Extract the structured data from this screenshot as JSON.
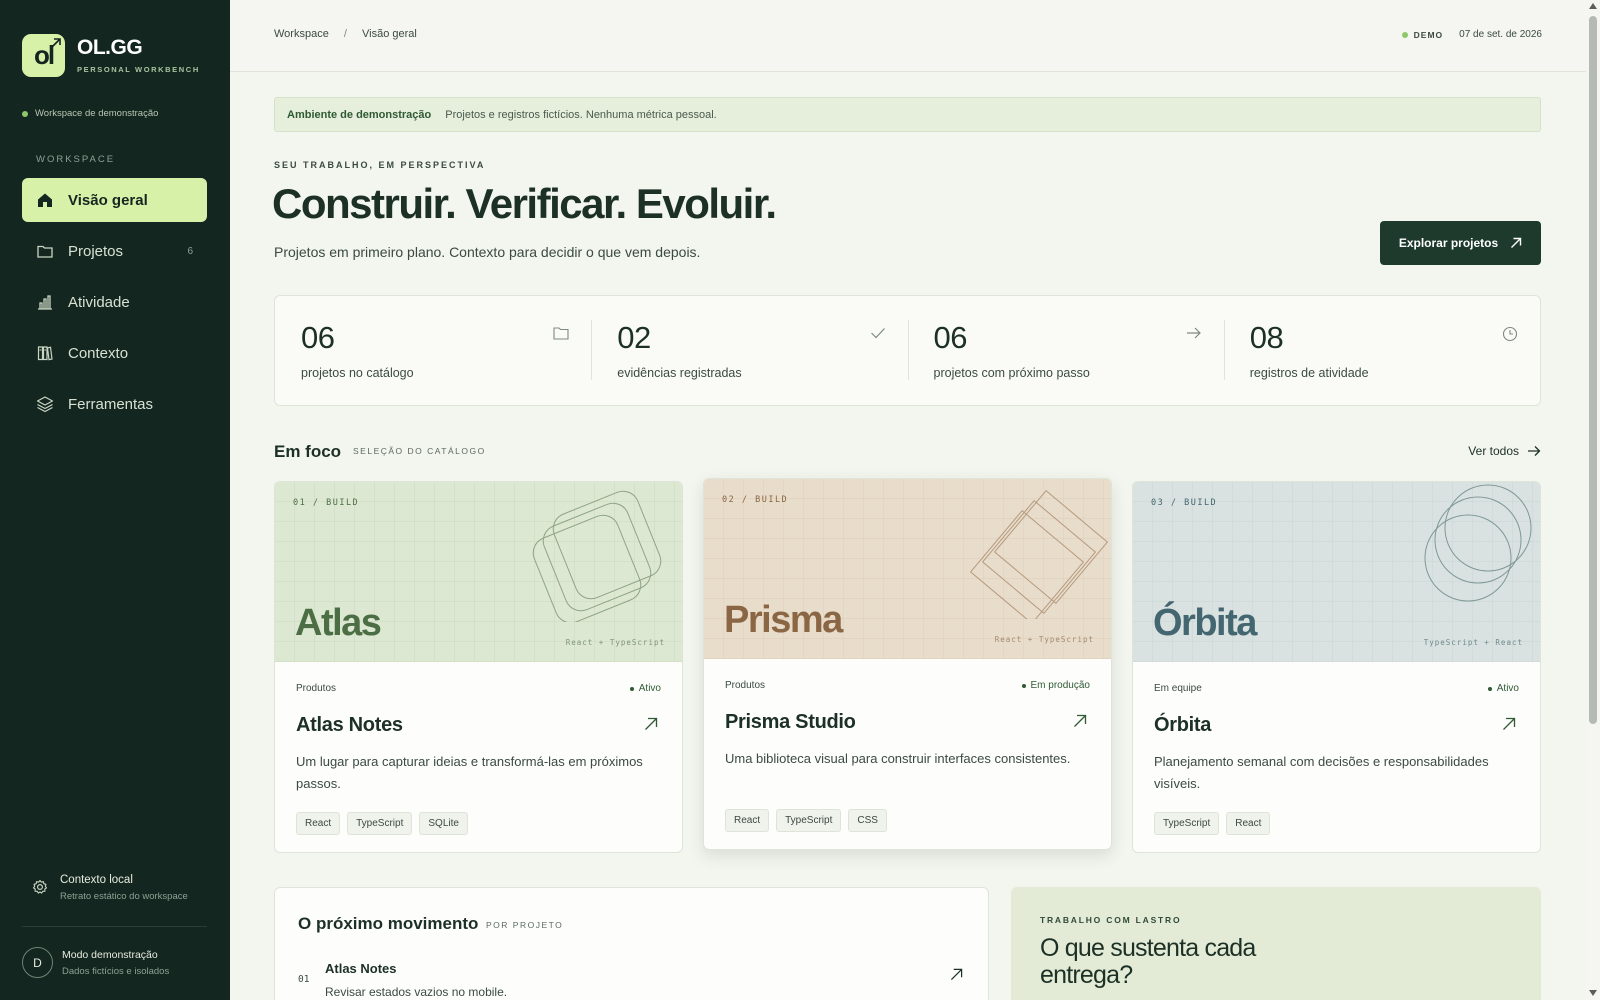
{
  "brand": {
    "logo_text": "ol",
    "name": "OL.GG",
    "subtitle": "PERSONAL WORKBENCH"
  },
  "sidebar": {
    "workspace_demo": "Workspace de demonstração",
    "section_label": "WORKSPACE",
    "items": [
      {
        "label": "Visão geral",
        "icon": "home-icon",
        "active": true
      },
      {
        "label": "Projetos",
        "icon": "folder-icon",
        "count": "6"
      },
      {
        "label": "Atividade",
        "icon": "bar-chart-icon"
      },
      {
        "label": "Contexto",
        "icon": "books-icon"
      },
      {
        "label": "Ferramentas",
        "icon": "layers-icon"
      }
    ],
    "context": {
      "title": "Contexto local",
      "subtitle": "Retrato estático do workspace"
    },
    "user": {
      "initial": "D",
      "title": "Modo demonstração",
      "subtitle": "Dados fictícios e isolados"
    }
  },
  "topbar": {
    "breadcrumb": [
      "Workspace",
      "Visão geral"
    ],
    "separator": "/",
    "demo_badge": "DEMO",
    "date": "07 de set. de 2026"
  },
  "banner": {
    "title": "Ambiente de demonstração",
    "text": "Projetos e registros fictícios. Nenhuma métrica pessoal."
  },
  "hero": {
    "kicker": "SEU TRABALHO, EM PERSPECTIVA",
    "title": "Construir. Verificar. Evoluir.",
    "subtitle": "Projetos em primeiro plano. Contexto para decidir o que vem depois.",
    "cta": "Explorar projetos"
  },
  "stats": [
    {
      "value": "06",
      "label": "projetos no catálogo",
      "icon": "folder-icon"
    },
    {
      "value": "02",
      "label": "evidências registradas",
      "icon": "check-icon"
    },
    {
      "value": "06",
      "label": "projetos com próximo passo",
      "icon": "arrow-right-icon"
    },
    {
      "value": "08",
      "label": "registros de atividade",
      "icon": "clock-icon"
    }
  ],
  "focus": {
    "title": "Em foco",
    "subtitle": "SELEÇÃO DO CATÁLOGO",
    "see_all": "Ver todos",
    "cards": [
      {
        "cover_label": "01 / BUILD",
        "cover_name": "Atlas",
        "cover_stack": "React + TypeScript",
        "category": "Produtos",
        "status": "Ativo",
        "title": "Atlas Notes",
        "description": "Um lugar para capturar ideias e transformá-las em próximos passos.",
        "tags": [
          "React",
          "TypeScript",
          "SQLite"
        ],
        "colors": {
          "bg": "#dde8d3",
          "text": "#4c6e45"
        }
      },
      {
        "cover_label": "02 / BUILD",
        "cover_name": "Prisma",
        "cover_stack": "React + TypeScript",
        "category": "Produtos",
        "status": "Em produção",
        "title": "Prisma Studio",
        "description": "Uma biblioteca visual para construir interfaces consistentes.",
        "tags": [
          "React",
          "TypeScript",
          "CSS"
        ],
        "colors": {
          "bg": "#e8dccb",
          "text": "#8a6644"
        }
      },
      {
        "cover_label": "03 / BUILD",
        "cover_name": "Órbita",
        "cover_stack": "TypeScript + React",
        "category": "Em equipe",
        "status": "Ativo",
        "title": "Órbita",
        "description": "Planejamento semanal com decisões e responsabilidades visíveis.",
        "tags": [
          "TypeScript",
          "React"
        ],
        "colors": {
          "bg": "#d9e2e0",
          "text": "#436670"
        }
      }
    ]
  },
  "next_move": {
    "title": "O próximo movimento",
    "subtitle": "POR PROJETO",
    "items": [
      {
        "number": "01",
        "project": "Atlas Notes",
        "task": "Revisar estados vazios no mobile."
      }
    ]
  },
  "lastro": {
    "kicker": "TRABALHO COM LASTRO",
    "question": "O que sustenta cada entrega?"
  },
  "colors": {
    "sidebar": "#142620",
    "accent": "#d8f1a9",
    "primary_button": "#1d3a2c",
    "page_bg": "#f3f5ef"
  }
}
